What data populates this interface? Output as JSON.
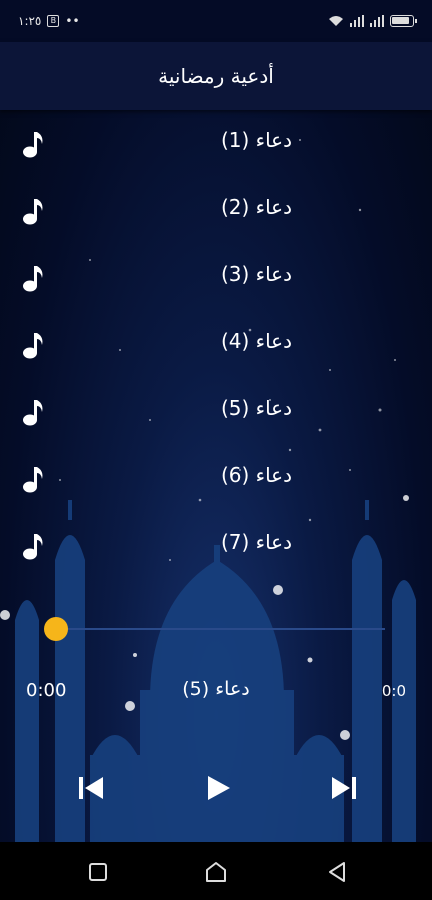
{
  "status_bar": {
    "time": "١:٢٥",
    "sim_badge": "B",
    "dots": "••",
    "battery_level": 0.9
  },
  "app_bar": {
    "title": "أدعية رمضانية"
  },
  "list": {
    "items": [
      {
        "label": "دعاء  (1)",
        "icon": "music-note-icon"
      },
      {
        "label": "دعاء  (2)",
        "icon": "music-note-icon"
      },
      {
        "label": "دعاء  (3)",
        "icon": "music-note-icon"
      },
      {
        "label": "دعاء  (4)",
        "icon": "music-note-icon"
      },
      {
        "label": "دعاء  (5)",
        "icon": "music-note-icon"
      },
      {
        "label": "دعاء  (6)",
        "icon": "music-note-icon"
      },
      {
        "label": "دعاء  (7)",
        "icon": "music-note-icon"
      }
    ]
  },
  "player": {
    "current_time": "0:00",
    "total_time": "0:0",
    "now_playing": "دعاء (5)",
    "progress": 0,
    "accent": "#f6b51a",
    "controls": [
      "skip-previous-icon",
      "play-icon",
      "skip-next-icon"
    ]
  },
  "nav_bar": {
    "buttons": [
      "recents-square-icon",
      "home-icon",
      "back-triangle-icon"
    ]
  }
}
